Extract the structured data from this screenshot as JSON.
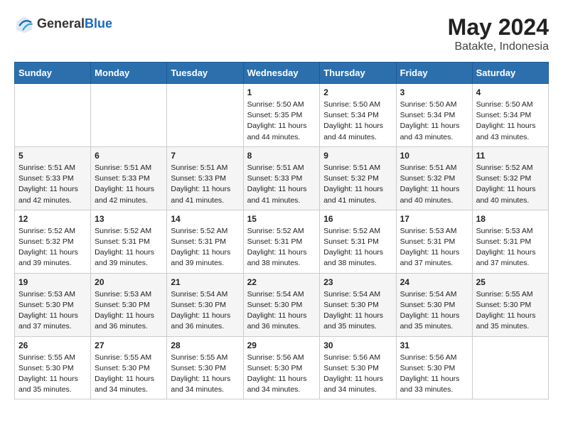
{
  "logo": {
    "general": "General",
    "blue": "Blue"
  },
  "title": {
    "month": "May 2024",
    "location": "Batakte, Indonesia"
  },
  "headers": [
    "Sunday",
    "Monday",
    "Tuesday",
    "Wednesday",
    "Thursday",
    "Friday",
    "Saturday"
  ],
  "weeks": [
    [
      {
        "day": "",
        "info": ""
      },
      {
        "day": "",
        "info": ""
      },
      {
        "day": "",
        "info": ""
      },
      {
        "day": "1",
        "info": "Sunrise: 5:50 AM\nSunset: 5:35 PM\nDaylight: 11 hours\nand 44 minutes."
      },
      {
        "day": "2",
        "info": "Sunrise: 5:50 AM\nSunset: 5:34 PM\nDaylight: 11 hours\nand 44 minutes."
      },
      {
        "day": "3",
        "info": "Sunrise: 5:50 AM\nSunset: 5:34 PM\nDaylight: 11 hours\nand 43 minutes."
      },
      {
        "day": "4",
        "info": "Sunrise: 5:50 AM\nSunset: 5:34 PM\nDaylight: 11 hours\nand 43 minutes."
      }
    ],
    [
      {
        "day": "5",
        "info": "Sunrise: 5:51 AM\nSunset: 5:33 PM\nDaylight: 11 hours\nand 42 minutes."
      },
      {
        "day": "6",
        "info": "Sunrise: 5:51 AM\nSunset: 5:33 PM\nDaylight: 11 hours\nand 42 minutes."
      },
      {
        "day": "7",
        "info": "Sunrise: 5:51 AM\nSunset: 5:33 PM\nDaylight: 11 hours\nand 41 minutes."
      },
      {
        "day": "8",
        "info": "Sunrise: 5:51 AM\nSunset: 5:33 PM\nDaylight: 11 hours\nand 41 minutes."
      },
      {
        "day": "9",
        "info": "Sunrise: 5:51 AM\nSunset: 5:32 PM\nDaylight: 11 hours\nand 41 minutes."
      },
      {
        "day": "10",
        "info": "Sunrise: 5:51 AM\nSunset: 5:32 PM\nDaylight: 11 hours\nand 40 minutes."
      },
      {
        "day": "11",
        "info": "Sunrise: 5:52 AM\nSunset: 5:32 PM\nDaylight: 11 hours\nand 40 minutes."
      }
    ],
    [
      {
        "day": "12",
        "info": "Sunrise: 5:52 AM\nSunset: 5:32 PM\nDaylight: 11 hours\nand 39 minutes."
      },
      {
        "day": "13",
        "info": "Sunrise: 5:52 AM\nSunset: 5:31 PM\nDaylight: 11 hours\nand 39 minutes."
      },
      {
        "day": "14",
        "info": "Sunrise: 5:52 AM\nSunset: 5:31 PM\nDaylight: 11 hours\nand 39 minutes."
      },
      {
        "day": "15",
        "info": "Sunrise: 5:52 AM\nSunset: 5:31 PM\nDaylight: 11 hours\nand 38 minutes."
      },
      {
        "day": "16",
        "info": "Sunrise: 5:52 AM\nSunset: 5:31 PM\nDaylight: 11 hours\nand 38 minutes."
      },
      {
        "day": "17",
        "info": "Sunrise: 5:53 AM\nSunset: 5:31 PM\nDaylight: 11 hours\nand 37 minutes."
      },
      {
        "day": "18",
        "info": "Sunrise: 5:53 AM\nSunset: 5:31 PM\nDaylight: 11 hours\nand 37 minutes."
      }
    ],
    [
      {
        "day": "19",
        "info": "Sunrise: 5:53 AM\nSunset: 5:30 PM\nDaylight: 11 hours\nand 37 minutes."
      },
      {
        "day": "20",
        "info": "Sunrise: 5:53 AM\nSunset: 5:30 PM\nDaylight: 11 hours\nand 36 minutes."
      },
      {
        "day": "21",
        "info": "Sunrise: 5:54 AM\nSunset: 5:30 PM\nDaylight: 11 hours\nand 36 minutes."
      },
      {
        "day": "22",
        "info": "Sunrise: 5:54 AM\nSunset: 5:30 PM\nDaylight: 11 hours\nand 36 minutes."
      },
      {
        "day": "23",
        "info": "Sunrise: 5:54 AM\nSunset: 5:30 PM\nDaylight: 11 hours\nand 35 minutes."
      },
      {
        "day": "24",
        "info": "Sunrise: 5:54 AM\nSunset: 5:30 PM\nDaylight: 11 hours\nand 35 minutes."
      },
      {
        "day": "25",
        "info": "Sunrise: 5:55 AM\nSunset: 5:30 PM\nDaylight: 11 hours\nand 35 minutes."
      }
    ],
    [
      {
        "day": "26",
        "info": "Sunrise: 5:55 AM\nSunset: 5:30 PM\nDaylight: 11 hours\nand 35 minutes."
      },
      {
        "day": "27",
        "info": "Sunrise: 5:55 AM\nSunset: 5:30 PM\nDaylight: 11 hours\nand 34 minutes."
      },
      {
        "day": "28",
        "info": "Sunrise: 5:55 AM\nSunset: 5:30 PM\nDaylight: 11 hours\nand 34 minutes."
      },
      {
        "day": "29",
        "info": "Sunrise: 5:56 AM\nSunset: 5:30 PM\nDaylight: 11 hours\nand 34 minutes."
      },
      {
        "day": "30",
        "info": "Sunrise: 5:56 AM\nSunset: 5:30 PM\nDaylight: 11 hours\nand 34 minutes."
      },
      {
        "day": "31",
        "info": "Sunrise: 5:56 AM\nSunset: 5:30 PM\nDaylight: 11 hours\nand 33 minutes."
      },
      {
        "day": "",
        "info": ""
      }
    ]
  ]
}
